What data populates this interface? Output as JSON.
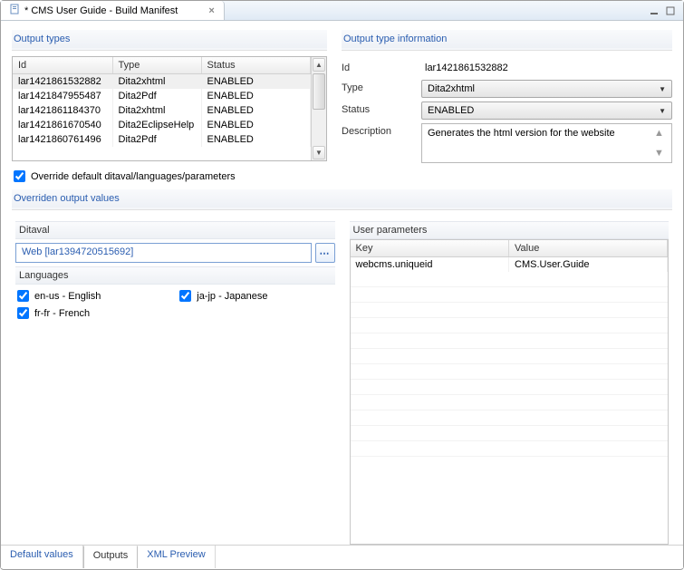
{
  "window": {
    "title": "* CMS User Guide - Build Manifest"
  },
  "panels": {
    "output_types": "Output types",
    "output_info": "Output type information",
    "override_values": "Overriden output values"
  },
  "output_table": {
    "headers": {
      "id": "Id",
      "type": "Type",
      "status": "Status"
    },
    "rows": [
      {
        "id": "lar1421861532882",
        "type": "Dita2xhtml",
        "status": "ENABLED"
      },
      {
        "id": "lar1421847955487",
        "type": "Dita2Pdf",
        "status": "ENABLED"
      },
      {
        "id": "lar1421861184370",
        "type": "Dita2xhtml",
        "status": "ENABLED"
      },
      {
        "id": "lar1421861670540",
        "type": "Dita2EclipseHelp",
        "status": "ENABLED"
      },
      {
        "id": "lar1421860761496",
        "type": "Dita2Pdf",
        "status": "ENABLED"
      }
    ]
  },
  "info": {
    "labels": {
      "id": "Id",
      "type": "Type",
      "status": "Status",
      "description": "Description"
    },
    "values": {
      "id": "lar1421861532882",
      "type": "Dita2xhtml",
      "status": "ENABLED",
      "description": "Generates the html version for the website"
    }
  },
  "override_checkbox_label": "Override default ditaval/languages/parameters",
  "override": {
    "ditaval_label": "Ditaval",
    "ditaval_value": "Web [lar1394720515692]",
    "languages_label": "Languages",
    "languages": [
      {
        "code": "en-us",
        "label": "en-us - English"
      },
      {
        "code": "ja-jp",
        "label": "ja-jp - Japanese"
      },
      {
        "code": "fr-fr",
        "label": "fr-fr - French"
      }
    ],
    "params_label": "User parameters",
    "params_headers": {
      "key": "Key",
      "value": "Value"
    },
    "params": [
      {
        "key": "webcms.uniqueid",
        "value": "CMS.User.Guide"
      }
    ]
  },
  "bottom_tabs": {
    "default_values": "Default values",
    "outputs": "Outputs",
    "xml_preview": "XML Preview"
  }
}
